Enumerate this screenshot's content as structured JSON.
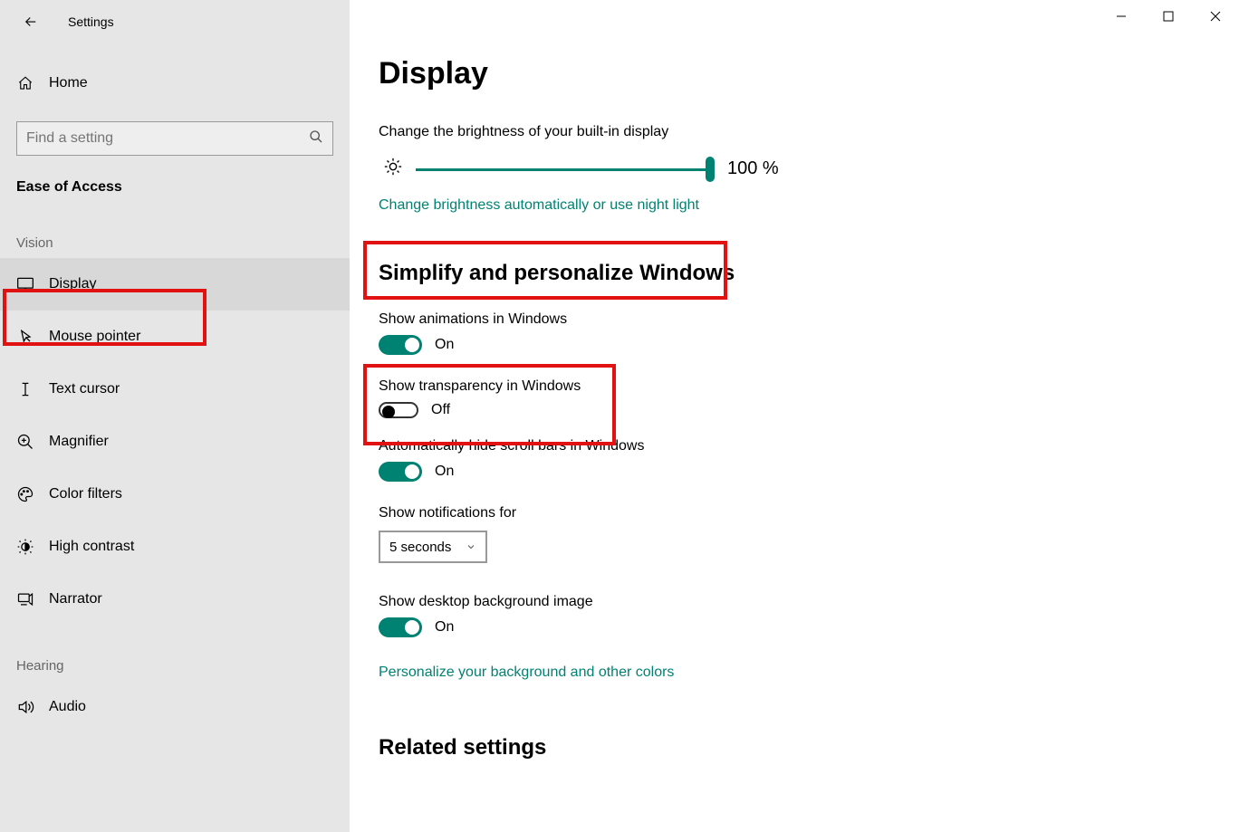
{
  "app_title": "Settings",
  "home_label": "Home",
  "search_placeholder": "Find a setting",
  "category_title": "Ease of Access",
  "groups": {
    "vision_label": "Vision",
    "hearing_label": "Hearing"
  },
  "nav": {
    "display": "Display",
    "mouse_pointer": "Mouse pointer",
    "text_cursor": "Text cursor",
    "magnifier": "Magnifier",
    "color_filters": "Color filters",
    "high_contrast": "High contrast",
    "narrator": "Narrator",
    "audio": "Audio"
  },
  "main": {
    "page_title": "Display",
    "brightness_label": "Change the brightness of your built-in display",
    "brightness_value": "100 %",
    "brightness_link": "Change brightness automatically or use night light",
    "section2_title": "Simplify and personalize Windows",
    "show_animations_label": "Show animations in Windows",
    "show_animations_state": "On",
    "show_transparency_label": "Show transparency in Windows",
    "show_transparency_state": "Off",
    "auto_hide_scroll_label": "Automatically hide scroll bars in Windows",
    "auto_hide_scroll_state": "On",
    "show_notifications_label": "Show notifications for",
    "notifications_value": "5 seconds",
    "show_desktop_bg_label": "Show desktop background image",
    "show_desktop_bg_state": "On",
    "personalize_link": "Personalize your background and other colors",
    "related_settings_title": "Related settings"
  },
  "colors": {
    "accent": "#008272",
    "highlight": "#e31212"
  }
}
